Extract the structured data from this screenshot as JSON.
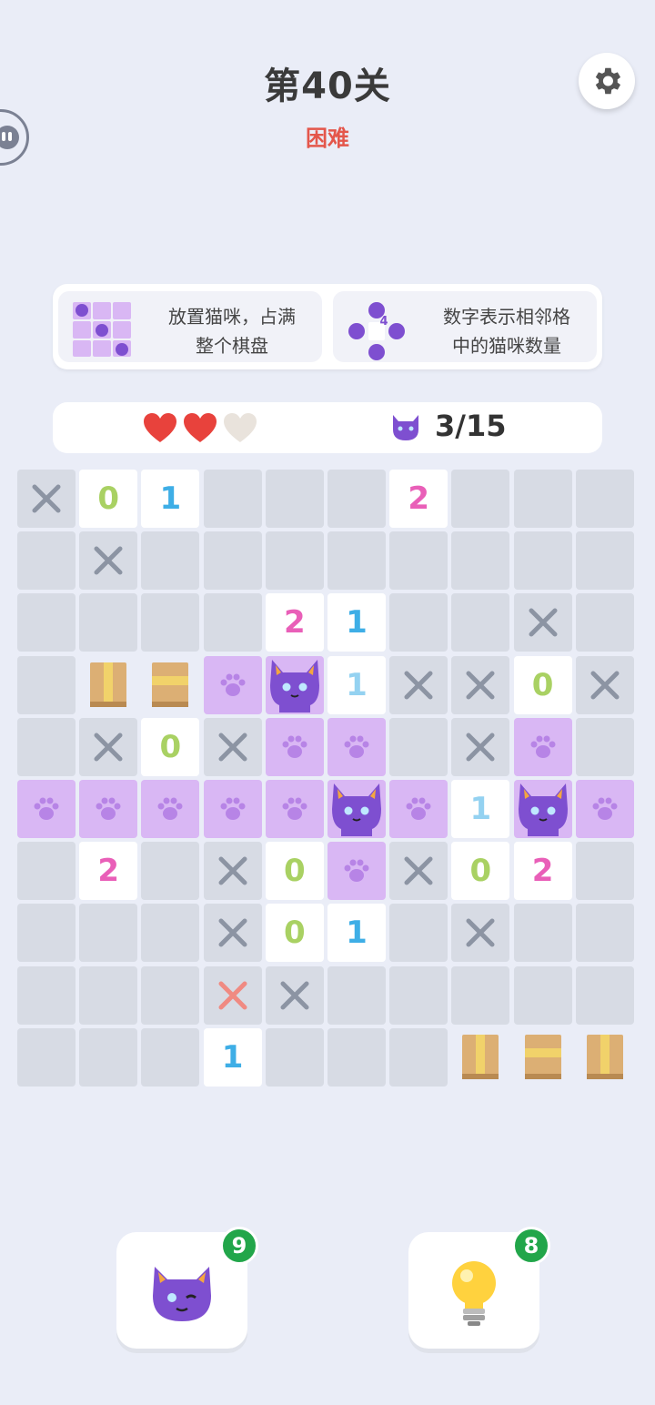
{
  "header": {
    "title": "第40关",
    "difficulty": "困难"
  },
  "icons": {
    "settings": "gear-icon",
    "side_tab": "face-icon",
    "lives": "heart-icon",
    "cat": "cat-icon",
    "hint": "lightbulb-icon"
  },
  "rules": [
    {
      "text_line1": "放置猫咪，占满",
      "text_line2": "整个棋盘"
    },
    {
      "text_line1": "数字表示相邻格",
      "text_line2": "中的猫咪数量",
      "example_number": "4"
    }
  ],
  "status": {
    "lives_total": 3,
    "lives_remaining": 2,
    "cat_count": "3/15"
  },
  "board": {
    "size": 10,
    "rows": [
      [
        "x",
        "0",
        "1",
        "e",
        "e",
        "e",
        "2",
        "e",
        "e",
        "e"
      ],
      [
        "e",
        "x",
        "e",
        "e",
        "e",
        "e",
        "e",
        "e",
        "e",
        "e"
      ],
      [
        "e",
        "e",
        "e",
        "e",
        "2",
        "1",
        "e",
        "e",
        "x",
        "e"
      ],
      [
        "e",
        "box",
        "box",
        "paw",
        "cat",
        "1f",
        "x",
        "x",
        "0",
        "x"
      ],
      [
        "e",
        "x",
        "0",
        "x",
        "paw",
        "paw",
        "e",
        "x",
        "paw",
        "e"
      ],
      [
        "paw",
        "paw",
        "paw",
        "paw",
        "paw",
        "cat",
        "paw",
        "1f",
        "cat",
        "paw"
      ],
      [
        "e",
        "2",
        "e",
        "x",
        "0",
        "paw",
        "x",
        "0",
        "2",
        "e"
      ],
      [
        "e",
        "e",
        "e",
        "x",
        "0",
        "1",
        "e",
        "x",
        "e",
        "e"
      ],
      [
        "e",
        "e",
        "e",
        "xr",
        "x",
        "e",
        "e",
        "e",
        "e",
        "e"
      ],
      [
        "e",
        "e",
        "e",
        "1",
        "e",
        "e",
        "e",
        "box",
        "box",
        "box"
      ]
    ]
  },
  "buttons": {
    "cat_tool": {
      "badge": "9"
    },
    "hint": {
      "badge": "8"
    }
  },
  "colors": {
    "background": "#eaedf7",
    "difficulty": "#e4564b",
    "paw_cell": "#d9b7f4",
    "num0": "#a9d163",
    "num1": "#3eaee6",
    "num2": "#e95fb8",
    "badge": "#22a64a"
  }
}
